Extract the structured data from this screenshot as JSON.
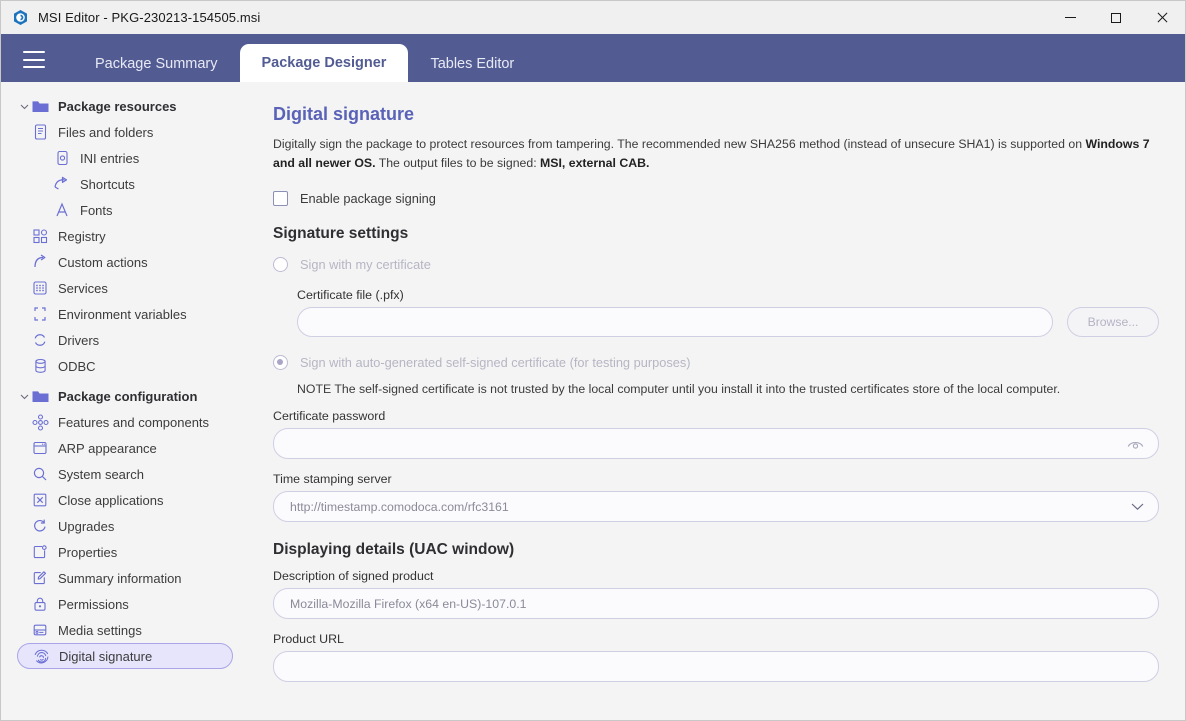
{
  "window": {
    "title": "MSI Editor - PKG-230213-154505.msi",
    "app_icon": "msi-editor-logo-icon",
    "controls": {
      "minimize": "minimize-icon",
      "maximize": "maximize-icon",
      "close": "close-icon"
    }
  },
  "header": {
    "menu_icon": "hamburger-menu-icon",
    "tabs": [
      {
        "label": "Package Summary",
        "active": false
      },
      {
        "label": "Package Designer",
        "active": true
      },
      {
        "label": "Tables Editor",
        "active": false
      }
    ]
  },
  "sidebar": {
    "items": [
      {
        "label": "Package resources",
        "icon": "folder-icon",
        "level": 0,
        "group": true,
        "expanded": true,
        "selected": false
      },
      {
        "label": "Files and folders",
        "icon": "document-icon",
        "level": 1,
        "group": false,
        "selected": false
      },
      {
        "label": "INI entries",
        "icon": "ini-file-icon",
        "level": 2,
        "group": false,
        "selected": false
      },
      {
        "label": "Shortcuts",
        "icon": "shortcut-arrow-icon",
        "level": 2,
        "group": false,
        "selected": false
      },
      {
        "label": "Fonts",
        "icon": "font-letter-a-icon",
        "level": 2,
        "group": false,
        "selected": false
      },
      {
        "label": "Registry",
        "icon": "registry-blocks-icon",
        "level": 1,
        "group": false,
        "selected": false
      },
      {
        "label": "Custom actions",
        "icon": "custom-action-arrow-icon",
        "level": 1,
        "group": false,
        "selected": false
      },
      {
        "label": "Services",
        "icon": "services-grid-icon",
        "level": 1,
        "group": false,
        "selected": false
      },
      {
        "label": "Environment variables",
        "icon": "environment-brackets-icon",
        "level": 1,
        "group": false,
        "selected": false
      },
      {
        "label": "Drivers",
        "icon": "drivers-refresh-icon",
        "level": 1,
        "group": false,
        "selected": false
      },
      {
        "label": "ODBC",
        "icon": "database-icon",
        "level": 1,
        "group": false,
        "selected": false
      },
      {
        "label": "Package configuration",
        "icon": "folder-icon",
        "level": 0,
        "group": true,
        "expanded": true,
        "selected": false
      },
      {
        "label": "Features and components",
        "icon": "features-nodes-icon",
        "level": 1,
        "group": false,
        "selected": false
      },
      {
        "label": "ARP appearance",
        "icon": "window-icon",
        "level": 1,
        "group": false,
        "selected": false
      },
      {
        "label": "System search",
        "icon": "search-icon",
        "level": 1,
        "group": false,
        "selected": false
      },
      {
        "label": "Close applications",
        "icon": "close-box-icon",
        "level": 1,
        "group": false,
        "selected": false
      },
      {
        "label": "Upgrades",
        "icon": "refresh-circle-icon",
        "level": 1,
        "group": false,
        "selected": false
      },
      {
        "label": "Properties",
        "icon": "properties-page-icon",
        "level": 1,
        "group": false,
        "selected": false
      },
      {
        "label": "Summary information",
        "icon": "edit-pencil-icon",
        "level": 1,
        "group": false,
        "selected": false
      },
      {
        "label": "Permissions",
        "icon": "lock-icon",
        "level": 1,
        "group": false,
        "selected": false
      },
      {
        "label": "Media settings",
        "icon": "media-disk-icon",
        "level": 1,
        "group": false,
        "selected": false
      },
      {
        "label": "Digital signature",
        "icon": "fingerprint-icon",
        "level": 1,
        "group": false,
        "selected": true
      }
    ]
  },
  "main": {
    "page_title": "Digital signature",
    "description": {
      "part1": "Digitally sign the package to protect resources from tampering. The recommended new SHA256 method (instead of unsecure SHA1) is supported on ",
      "bold1": "Windows 7 and all newer OS.",
      "part2": " The output files to be signed: ",
      "bold2": "MSI, external CAB."
    },
    "enable_signing": {
      "label": "Enable package signing",
      "checked": false
    },
    "signature_settings": {
      "heading": "Signature settings",
      "radio_my_cert": {
        "label": "Sign with my certificate",
        "selected": false,
        "disabled": true
      },
      "certificate_file": {
        "label": "Certificate file (.pfx)",
        "value": "",
        "browse_label": "Browse..."
      },
      "radio_self_signed": {
        "label": "Sign with auto-generated self-signed certificate (for testing purposes)",
        "selected": true,
        "disabled": true
      },
      "note": "NOTE The self-signed certificate is not trusted by the local computer until you install it into the trusted certificates store of the local computer.",
      "certificate_password": {
        "label": "Certificate password",
        "value": "",
        "reveal_icon": "eye-icon"
      },
      "timestamp_server": {
        "label": "Time stamping server",
        "value": "http://timestamp.comodoca.com/rfc3161",
        "chevron_icon": "chevron-down-icon"
      }
    },
    "uac": {
      "heading": "Displaying details (UAC window)",
      "description_field": {
        "label": "Description of signed product",
        "value": "Mozilla-Mozilla Firefox (x64 en-US)-107.0.1"
      },
      "url_field": {
        "label": "Product URL",
        "value": ""
      }
    }
  },
  "colors": {
    "header_bg": "#535c92",
    "accent": "#5a62b8",
    "selected_item_bg": "#e7e5fb",
    "selected_item_border": "#a9a5e8",
    "icon_purple": "#6b6fd4",
    "page_bg": "#f4f4f4"
  }
}
